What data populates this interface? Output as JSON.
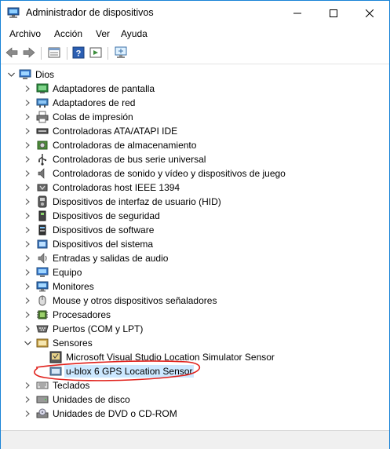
{
  "window": {
    "title": "Administrador de dispositivos",
    "title_icon": "device-manager-icon",
    "accent_color": "#1883d7",
    "controls": [
      "minimize-icon",
      "maximize-icon",
      "close-icon"
    ]
  },
  "menu": {
    "items": [
      {
        "label": "Archivo"
      },
      {
        "label": "Acción"
      },
      {
        "label": "Ver"
      },
      {
        "label": "Ayuda"
      }
    ]
  },
  "toolbar": {
    "buttons": [
      "back-arrow-icon",
      "forward-arrow-icon",
      "properties-icon",
      "help-icon",
      "view-icon",
      "monitor-scan-icon"
    ]
  },
  "tree": {
    "root": {
      "label": "Dios",
      "icon": "computer-icon",
      "expanded": true
    },
    "categories": [
      {
        "label": "Adaptadores de pantalla",
        "icon": "display-adapter-icon"
      },
      {
        "label": "Adaptadores de red",
        "icon": "network-adapter-icon"
      },
      {
        "label": "Colas de impresión",
        "icon": "print-queue-icon"
      },
      {
        "label": "Controladoras ATA/ATAPI IDE",
        "icon": "ide-controller-icon"
      },
      {
        "label": "Controladoras de almacenamiento",
        "icon": "storage-controller-icon"
      },
      {
        "label": "Controladoras de bus serie universal",
        "icon": "usb-icon"
      },
      {
        "label": "Controladoras de sonido y vídeo y dispositivos de juego",
        "icon": "speaker-icon"
      },
      {
        "label": "Controladoras host IEEE 1394",
        "icon": "firewire-icon"
      },
      {
        "label": "Dispositivos de interfaz de usuario (HID)",
        "icon": "hid-icon"
      },
      {
        "label": "Dispositivos de seguridad",
        "icon": "security-device-icon"
      },
      {
        "label": "Dispositivos de software",
        "icon": "software-device-icon"
      },
      {
        "label": "Dispositivos del sistema",
        "icon": "system-device-icon"
      },
      {
        "label": "Entradas y salidas de audio",
        "icon": "audio-io-icon"
      },
      {
        "label": "Equipo",
        "icon": "computer-icon"
      },
      {
        "label": "Monitores",
        "icon": "monitor-icon"
      },
      {
        "label": "Mouse y otros dispositivos señaladores",
        "icon": "mouse-icon"
      },
      {
        "label": "Procesadores",
        "icon": "processor-icon"
      },
      {
        "label": "Puertos (COM y LPT)",
        "icon": "port-icon"
      },
      {
        "label": "Sensores",
        "icon": "sensor-icon",
        "expanded": true,
        "children": [
          {
            "label": "Microsoft Visual Studio Location Simulator Sensor",
            "icon": "location-sensor-icon"
          },
          {
            "label": "u-blox 6 GPS Location Sensor",
            "icon": "gps-sensor-icon",
            "selected": true
          }
        ]
      },
      {
        "label": "Teclados",
        "icon": "keyboard-icon"
      },
      {
        "label": "Unidades de disco",
        "icon": "disk-drive-icon"
      },
      {
        "label": "Unidades de DVD o CD-ROM",
        "icon": "dvd-drive-icon"
      }
    ]
  },
  "annotation": {
    "color": "#e0201b"
  }
}
